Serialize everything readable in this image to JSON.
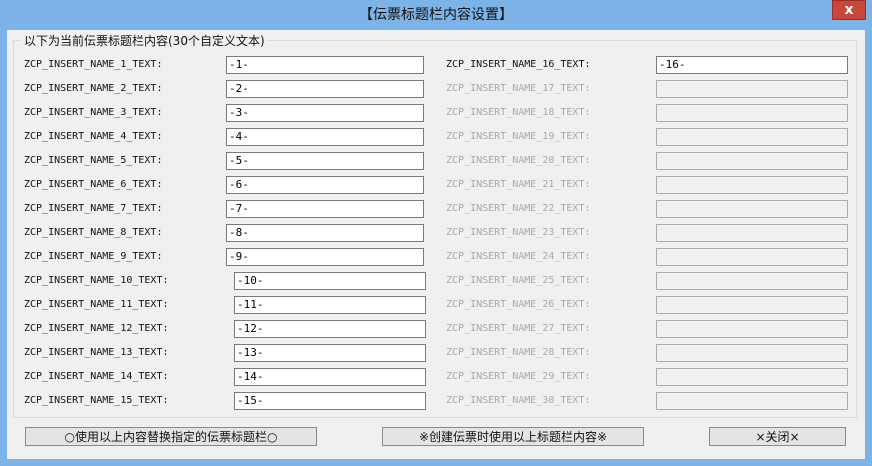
{
  "window": {
    "title": "【伝票标题栏内容设置】",
    "close_glyph": "x"
  },
  "group": {
    "legend": "以下为当前伝票标题栏内容(30个自定义文本)"
  },
  "left_fields": [
    {
      "label": "ZCP_INSERT_NAME_1_TEXT:",
      "value": "-1-"
    },
    {
      "label": "ZCP_INSERT_NAME_2_TEXT:",
      "value": "-2-"
    },
    {
      "label": "ZCP_INSERT_NAME_3_TEXT:",
      "value": "-3-"
    },
    {
      "label": "ZCP_INSERT_NAME_4_TEXT:",
      "value": "-4-"
    },
    {
      "label": "ZCP_INSERT_NAME_5_TEXT:",
      "value": "-5-"
    },
    {
      "label": "ZCP_INSERT_NAME_6_TEXT:",
      "value": "-6-"
    },
    {
      "label": "ZCP_INSERT_NAME_7_TEXT:",
      "value": "-7-"
    },
    {
      "label": "ZCP_INSERT_NAME_8_TEXT:",
      "value": "-8-"
    },
    {
      "label": "ZCP_INSERT_NAME_9_TEXT:",
      "value": "-9-"
    },
    {
      "label": "ZCP_INSERT_NAME_10_TEXT:",
      "value": "-10-"
    },
    {
      "label": "ZCP_INSERT_NAME_11_TEXT:",
      "value": "-11-"
    },
    {
      "label": "ZCP_INSERT_NAME_12_TEXT:",
      "value": "-12-"
    },
    {
      "label": "ZCP_INSERT_NAME_13_TEXT:",
      "value": "-13-"
    },
    {
      "label": "ZCP_INSERT_NAME_14_TEXT:",
      "value": "-14-"
    },
    {
      "label": "ZCP_INSERT_NAME_15_TEXT:",
      "value": "-15-"
    }
  ],
  "right_fields": [
    {
      "label": "ZCP_INSERT_NAME_16_TEXT:",
      "value": "-16-",
      "enabled": true
    },
    {
      "label": "ZCP_INSERT_NAME_17_TEXT:",
      "value": "",
      "enabled": false
    },
    {
      "label": "ZCP_INSERT_NAME_18_TEXT:",
      "value": "",
      "enabled": false
    },
    {
      "label": "ZCP_INSERT_NAME_19_TEXT:",
      "value": "",
      "enabled": false
    },
    {
      "label": "ZCP_INSERT_NAME_20_TEXT:",
      "value": "",
      "enabled": false
    },
    {
      "label": "ZCP_INSERT_NAME_21_TEXT:",
      "value": "",
      "enabled": false
    },
    {
      "label": "ZCP_INSERT_NAME_22_TEXT:",
      "value": "",
      "enabled": false
    },
    {
      "label": "ZCP_INSERT_NAME_23_TEXT:",
      "value": "",
      "enabled": false
    },
    {
      "label": "ZCP_INSERT_NAME_24_TEXT:",
      "value": "",
      "enabled": false
    },
    {
      "label": "ZCP_INSERT_NAME_25_TEXT:",
      "value": "",
      "enabled": false
    },
    {
      "label": "ZCP_INSERT_NAME_26_TEXT:",
      "value": "",
      "enabled": false
    },
    {
      "label": "ZCP_INSERT_NAME_27_TEXT:",
      "value": "",
      "enabled": false
    },
    {
      "label": "ZCP_INSERT_NAME_28_TEXT:",
      "value": "",
      "enabled": false
    },
    {
      "label": "ZCP_INSERT_NAME_29_TEXT:",
      "value": "",
      "enabled": false
    },
    {
      "label": "ZCP_INSERT_NAME_30_TEXT:",
      "value": "",
      "enabled": false
    }
  ],
  "buttons": {
    "replace": "○使用以上内容替换指定的伝票标题栏○",
    "use_on_create": "※创建伝票时使用以上标题栏内容※",
    "close": "×关闭×"
  },
  "colors": {
    "titlebar": "#7db4e8",
    "close_button": "#c7483a",
    "client": "#f0f0f0"
  }
}
